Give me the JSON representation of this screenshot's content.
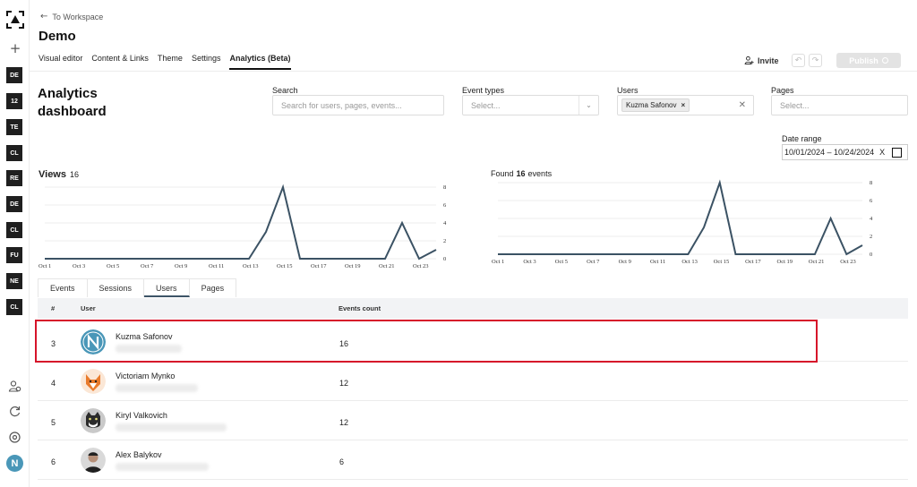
{
  "rail": {
    "projects": [
      "DE",
      "12",
      "TE",
      "CL",
      "RE",
      "DE",
      "CL",
      "FU",
      "NE",
      "CL"
    ],
    "avatar_letter": "N"
  },
  "header": {
    "back_label": "To Workspace",
    "title": "Demo",
    "tabs": [
      "Visual editor",
      "Content & Links",
      "Theme",
      "Settings",
      "Analytics (Beta)"
    ],
    "active_tab": "Analytics (Beta)",
    "invite_label": "Invite",
    "publish_label": "Publish"
  },
  "dashboard": {
    "title": "Analytics dashboard"
  },
  "filters": {
    "search_label": "Search",
    "search_placeholder": "Search for users, pages, events...",
    "event_types_label": "Event types",
    "event_types_placeholder": "Select...",
    "users_label": "Users",
    "users_selected": "Kuzma Safonov",
    "pages_label": "Pages",
    "pages_placeholder": "Select...",
    "date_range_label": "Date range",
    "date_range_value": "10/01/2024 – 10/24/2024",
    "date_clear": "X"
  },
  "views": {
    "label": "Views",
    "count": "16"
  },
  "found": {
    "prefix": "Found",
    "count": "16",
    "suffix": "events"
  },
  "chart_data": [
    {
      "type": "line",
      "x": [
        "Oct 1",
        "Oct 2",
        "Oct 3",
        "Oct 4",
        "Oct 5",
        "Oct 6",
        "Oct 7",
        "Oct 8",
        "Oct 9",
        "Oct 10",
        "Oct 11",
        "Oct 12",
        "Oct 13",
        "Oct 14",
        "Oct 15",
        "Oct 16",
        "Oct 17",
        "Oct 18",
        "Oct 19",
        "Oct 20",
        "Oct 21",
        "Oct 22",
        "Oct 23",
        "Oct 24"
      ],
      "tick_labels": [
        "Oct 1",
        "Oct 3",
        "Oct 5",
        "Oct 7",
        "Oct 9",
        "Oct 11",
        "Oct 13",
        "Oct 15",
        "Oct 17",
        "Oct 19",
        "Oct 21",
        "Oct 23"
      ],
      "values": [
        0,
        0,
        0,
        0,
        0,
        0,
        0,
        0,
        0,
        0,
        0,
        0,
        0,
        3,
        8,
        0,
        0,
        0,
        0,
        0,
        0,
        4,
        0,
        1
      ],
      "ylim": [
        0,
        8
      ],
      "y_ticks": [
        0,
        2,
        4,
        6,
        8
      ],
      "grid": true,
      "color": "#3b5264"
    },
    {
      "type": "line",
      "x": [
        "Oct 1",
        "Oct 2",
        "Oct 3",
        "Oct 4",
        "Oct 5",
        "Oct 6",
        "Oct 7",
        "Oct 8",
        "Oct 9",
        "Oct 10",
        "Oct 11",
        "Oct 12",
        "Oct 13",
        "Oct 14",
        "Oct 15",
        "Oct 16",
        "Oct 17",
        "Oct 18",
        "Oct 19",
        "Oct 20",
        "Oct 21",
        "Oct 22",
        "Oct 23",
        "Oct 24"
      ],
      "tick_labels": [
        "Oct 1",
        "Oct 3",
        "Oct 5",
        "Oct 7",
        "Oct 9",
        "Oct 11",
        "Oct 13",
        "Oct 15",
        "Oct 17",
        "Oct 19",
        "Oct 21",
        "Oct 23"
      ],
      "values": [
        0,
        0,
        0,
        0,
        0,
        0,
        0,
        0,
        0,
        0,
        0,
        0,
        0,
        3,
        8,
        0,
        0,
        0,
        0,
        0,
        0,
        4,
        0,
        1
      ],
      "ylim": [
        0,
        8
      ],
      "y_ticks": [
        0,
        2,
        4,
        6,
        8
      ],
      "grid": true,
      "color": "#3b5264"
    }
  ],
  "table_tabs": [
    "Events",
    "Sessions",
    "Users",
    "Pages"
  ],
  "active_table_tab": "Users",
  "table": {
    "columns": [
      "#",
      "User",
      "Events count"
    ],
    "rows": [
      {
        "idx": "3",
        "name": "Kuzma Safonov",
        "count": "16",
        "avatar": "n-logo"
      },
      {
        "idx": "4",
        "name": "Victoriam Mynko",
        "count": "12",
        "avatar": "fox"
      },
      {
        "idx": "5",
        "name": "Kiryl Valkovich",
        "count": "12",
        "avatar": "cat"
      },
      {
        "idx": "6",
        "name": "Alex Balykov",
        "count": "6",
        "avatar": "person"
      }
    ]
  },
  "colors": {
    "accent": "#3b5264",
    "highlight": "#d6142a",
    "avatar_brand": "#4a97b8"
  }
}
